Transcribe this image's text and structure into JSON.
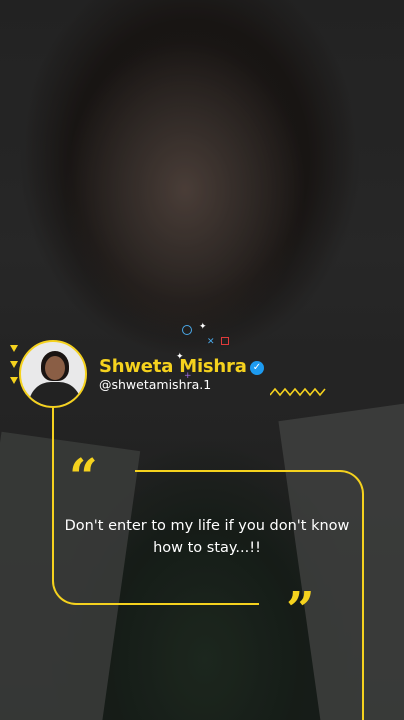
{
  "profile": {
    "name": "Shweta Mishra",
    "handle": "@shwetamishra.1",
    "verified_glyph": "✓"
  },
  "quote": {
    "text": "Don't enter to my life if you don't know how to stay...!!",
    "open_mark": "“",
    "close_mark": "”"
  },
  "colors": {
    "accent": "#f5d21e",
    "verified": "#1d9bf0",
    "text": "#ffffff"
  },
  "icons": {
    "avatar": "profile-photo",
    "verified": "verified-badge-icon",
    "triangles": "triangle-markers-icon",
    "zigzag": "zigzag-decoration-icon",
    "confetti": "confetti-decoration-icon"
  }
}
